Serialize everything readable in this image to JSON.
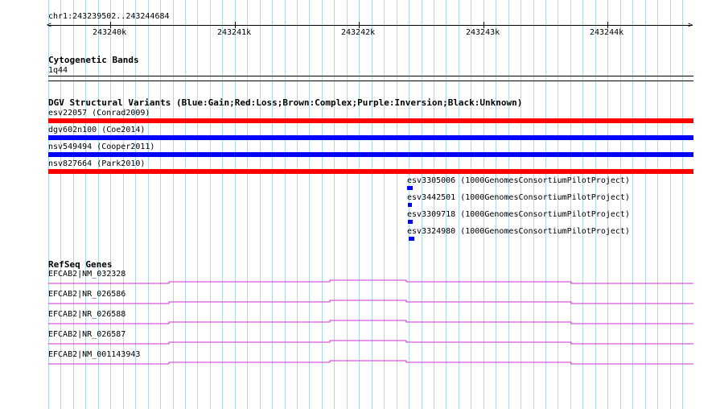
{
  "ruler": {
    "location": "chr1:243239502..243244684",
    "ticks": [
      "243240k",
      "243241k",
      "243242k",
      "243243k",
      "243244k"
    ]
  },
  "cytobands": {
    "title": "Cytogenetic Bands",
    "band": "1q44"
  },
  "dgv": {
    "title": "DGV Structural Variants (Blue:Gain;Red:Loss;Brown:Complex;Purple:Inversion;Black:Unknown)",
    "variants": [
      {
        "label": "esv22057 (Conrad2009)",
        "color": "#ff0000"
      },
      {
        "label": "dgv602n100 (Coe2014)",
        "color": "#0000ff"
      },
      {
        "label": "nsv549494 (Cooper2011)",
        "color": "#0000ff"
      },
      {
        "label": "nsv827664 (Park2010)",
        "color": "#ff0000"
      }
    ],
    "small_variants": [
      {
        "label": "esv3305006 (1000GenomesConsortiumPilotProject)",
        "color": "#0000ff"
      },
      {
        "label": "esv3442501 (1000GenomesConsortiumPilotProject)",
        "color": "#0000ff"
      },
      {
        "label": "esv3309718 (1000GenomesConsortiumPilotProject)",
        "color": "#0000ff"
      },
      {
        "label": "esv3324980 (1000GenomesConsortiumPilotProject)",
        "color": "#0000ff"
      }
    ]
  },
  "refseq": {
    "title": "RefSeq Genes",
    "genes": [
      {
        "label": "EFCAB2|NM_032328"
      },
      {
        "label": "EFCAB2|NR_026586"
      },
      {
        "label": "EFCAB2|NR_026588"
      },
      {
        "label": "EFCAB2|NR_026587"
      },
      {
        "label": "EFCAB2|NM_001143943"
      }
    ],
    "color": "#cc33cc"
  },
  "colors": {
    "grid": "#aadde8",
    "loss": "#ff0000",
    "gain": "#0000ff",
    "gene": "#cc33cc"
  }
}
